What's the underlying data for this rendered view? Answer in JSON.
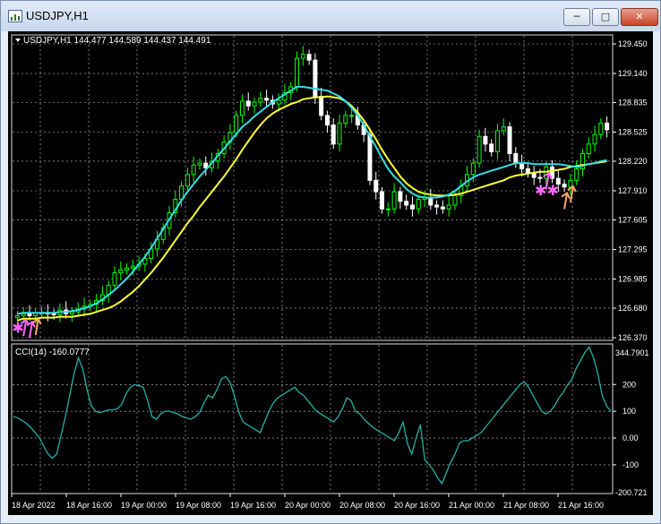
{
  "window": {
    "title": "USDJPY,H1",
    "minimize_glyph": "─",
    "maximize_glyph": "□",
    "close_glyph": "✕",
    "icon": "chart-window-icon"
  },
  "main_chart": {
    "header": "USDJPY,H1  144.477 144.589 144.437 144.491",
    "price_labels": [
      "129.450",
      "129.140",
      "128.835",
      "128.525",
      "128.220",
      "127.910",
      "127.605",
      "127.295",
      "126.985",
      "126.680",
      "126.370"
    ],
    "price_values": [
      129.45,
      129.14,
      128.835,
      128.525,
      128.22,
      127.91,
      127.605,
      127.295,
      126.985,
      126.68,
      126.37
    ],
    "ylim": [
      126.37,
      129.45
    ]
  },
  "indicator": {
    "header": "CCI(14) -160.0777",
    "max_label": "344.7901",
    "min_label": "-200.721",
    "level_labels": [
      "200",
      "100",
      "0.00",
      "-100"
    ],
    "level_values": [
      200,
      100,
      0,
      -100
    ],
    "ylim": [
      -200.721,
      344.7901
    ]
  },
  "time_axis": {
    "labels": [
      "18 Apr 2022",
      "18 Apr 16:00",
      "19 Apr 00:00",
      "19 Apr 08:00",
      "19 Apr 16:00",
      "20 Apr 00:00",
      "20 Apr 08:00",
      "20 Apr 16:00",
      "21 Apr 00:00",
      "21 Apr 08:00",
      "21 Apr 16:00"
    ]
  },
  "colors": {
    "background": "#000000",
    "grid": "#c8c8c8",
    "candle_up": "#00ff00",
    "candle_down": "#ffffff",
    "ma_fast": "#33dde6",
    "ma_slow": "#ffff33",
    "cci_line": "#20b2aa",
    "arrow_magenta": "#ff66ff",
    "arrow_orange": "#ffaa66"
  },
  "chart_data": {
    "type": "candlestick",
    "symbol": "USDJPY",
    "timeframe": "H1",
    "ylim": [
      126.37,
      129.45
    ],
    "close": [
      126.6,
      126.62,
      126.6,
      126.63,
      126.63,
      126.62,
      126.61,
      126.66,
      126.62,
      126.64,
      126.67,
      126.7,
      126.72,
      126.76,
      126.82,
      126.92,
      127.05,
      127.08,
      127.1,
      127.12,
      127.14,
      127.2,
      127.3,
      127.4,
      127.52,
      127.68,
      127.82,
      127.96,
      128.08,
      128.18,
      128.2,
      128.15,
      128.22,
      128.3,
      128.42,
      128.52,
      128.7,
      128.85,
      128.8,
      128.84,
      128.88,
      128.86,
      128.82,
      128.86,
      128.94,
      129.0,
      129.3,
      129.34,
      129.28,
      128.9,
      128.7,
      128.6,
      128.4,
      128.62,
      128.7,
      128.7,
      128.6,
      128.5,
      128.02,
      127.9,
      127.72,
      127.72,
      127.9,
      127.8,
      127.76,
      127.72,
      127.82,
      127.84,
      127.76,
      127.74,
      127.72,
      127.76,
      127.86,
      127.96,
      128.08,
      128.2,
      128.48,
      128.4,
      128.32,
      128.54,
      128.58,
      128.3,
      128.2,
      128.14,
      128.1,
      128.05,
      128.04,
      128.16,
      128.04,
      127.98,
      127.95,
      128.02,
      128.14,
      128.3,
      128.4,
      128.5,
      128.62,
      128.55
    ],
    "ma_fast": [
      126.62,
      126.63,
      126.63,
      126.63,
      126.63,
      126.63,
      126.63,
      126.64,
      126.64,
      126.65,
      126.66,
      126.68,
      126.7,
      126.73,
      126.77,
      126.82,
      126.87,
      126.93,
      126.99,
      127.06,
      127.14,
      127.22,
      127.31,
      127.41,
      127.51,
      127.61,
      127.71,
      127.81,
      127.9,
      127.98,
      128.06,
      128.13,
      128.2,
      128.28,
      128.35,
      128.43,
      128.5,
      128.58,
      128.63,
      128.69,
      128.74,
      128.79,
      128.84,
      128.88,
      128.92,
      128.96,
      129.0,
      129.0,
      128.99,
      128.98,
      128.97,
      128.96,
      128.93,
      128.9,
      128.85,
      128.78,
      128.7,
      128.6,
      128.48,
      128.37,
      128.25,
      128.14,
      128.06,
      128.0,
      127.93,
      127.88,
      127.85,
      127.84,
      127.84,
      127.84,
      127.85,
      127.87,
      127.91,
      127.96,
      128.01,
      128.05,
      128.08,
      128.1,
      128.12,
      128.14,
      128.16,
      128.18,
      128.2,
      128.2,
      128.2,
      128.19,
      128.19,
      128.19,
      128.19,
      128.19,
      128.18,
      128.17,
      128.16,
      128.17,
      128.19,
      128.2,
      128.22,
      128.23
    ],
    "ma_slow": [
      126.55,
      126.57,
      126.57,
      126.57,
      126.58,
      126.58,
      126.58,
      126.59,
      126.59,
      126.59,
      126.6,
      126.61,
      126.62,
      126.64,
      126.66,
      126.68,
      126.71,
      126.75,
      126.8,
      126.85,
      126.91,
      126.98,
      127.05,
      127.13,
      127.21,
      127.3,
      127.39,
      127.48,
      127.57,
      127.65,
      127.74,
      127.82,
      127.9,
      127.98,
      128.06,
      128.15,
      128.24,
      128.34,
      128.43,
      128.52,
      128.6,
      128.67,
      128.72,
      128.76,
      128.79,
      128.82,
      128.84,
      128.87,
      128.88,
      128.89,
      128.89,
      128.9,
      128.89,
      128.88,
      128.85,
      128.8,
      128.73,
      128.65,
      128.55,
      128.45,
      128.34,
      128.24,
      128.15,
      128.06,
      127.99,
      127.94,
      127.9,
      127.88,
      127.87,
      127.86,
      127.86,
      127.86,
      127.87,
      127.88,
      127.9,
      127.92,
      127.94,
      127.96,
      127.98,
      128.0,
      128.02,
      128.05,
      128.07,
      128.08,
      128.09,
      128.1,
      128.11,
      128.11,
      128.12,
      128.13,
      128.14,
      128.16,
      128.17,
      128.18,
      128.19,
      128.2,
      128.21,
      128.22
    ],
    "cci": [
      80,
      75,
      65,
      55,
      40,
      20,
      0,
      -30,
      -60,
      -75,
      -60,
      10,
      80,
      160,
      240,
      300,
      260,
      180,
      120,
      100,
      95,
      100,
      105,
      105,
      110,
      125,
      165,
      190,
      200,
      195,
      190,
      140,
      80,
      70,
      90,
      100,
      100,
      95,
      90,
      80,
      75,
      70,
      80,
      95,
      130,
      160,
      150,
      180,
      220,
      230,
      210,
      160,
      100,
      60,
      50,
      40,
      30,
      20,
      60,
      100,
      130,
      150,
      160,
      170,
      180,
      190,
      170,
      160,
      140,
      120,
      100,
      90,
      80,
      70,
      60,
      80,
      110,
      150,
      140,
      100,
      90,
      70,
      55,
      40,
      30,
      20,
      10,
      0,
      -10,
      20,
      60,
      -20,
      -60,
      0,
      50,
      -80,
      -100,
      -120,
      -150,
      -170,
      -130,
      -90,
      -60,
      -20,
      -10,
      -10,
      0,
      10,
      20,
      40,
      60,
      80,
      100,
      120,
      140,
      160,
      180,
      200,
      210,
      190,
      160,
      130,
      100,
      90,
      100,
      120,
      150,
      170,
      200,
      220,
      260,
      290,
      320,
      340,
      300,
      240,
      160,
      120,
      100
    ],
    "arrows": [
      {
        "index": 0,
        "kind": "star",
        "color": "magenta"
      },
      {
        "index": 1,
        "kind": "up-arrow",
        "color": "magenta"
      },
      {
        "index": 2,
        "kind": "up-arrow",
        "color": "magenta"
      },
      {
        "index": 3,
        "kind": "up-arrow",
        "color": "orange"
      },
      {
        "index": 86,
        "kind": "star",
        "color": "magenta"
      },
      {
        "index": 87,
        "kind": "up-arrow",
        "color": "magenta"
      },
      {
        "index": 88,
        "kind": "star",
        "color": "magenta"
      },
      {
        "index": 90,
        "kind": "up-arrow",
        "color": "orange"
      },
      {
        "index": 91,
        "kind": "up-arrow",
        "color": "orange"
      }
    ]
  }
}
